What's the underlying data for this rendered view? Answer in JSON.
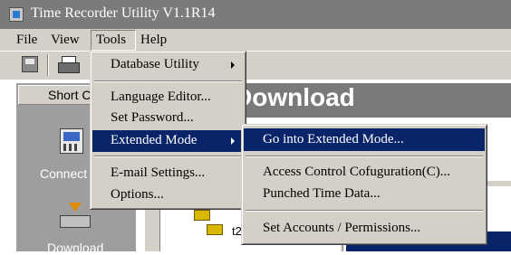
{
  "window": {
    "title": "Time Recorder Utility V1.1R14",
    "icon": "app-icon"
  },
  "menubar": {
    "file": "File",
    "view": "View",
    "tools": "Tools",
    "help": "Help"
  },
  "toolbar": {
    "save_icon": "save-icon",
    "print_icon": "printer-icon"
  },
  "shortcut_panel": {
    "header": "Short Cut",
    "connect_label": "Connect",
    "download_label": "Download"
  },
  "content": {
    "title": "Download",
    "tree_item_label": "t2"
  },
  "tools_menu": {
    "database_utility": "Database Utility",
    "language_editor": "Language Editor...",
    "set_password": "Set Password...",
    "extended_mode": "Extended Mode",
    "email_settings": "E-mail Settings...",
    "options": "Options..."
  },
  "extended_submenu": {
    "go_into": "Go into Extended Mode...",
    "access_control": "Access Control Cofuguration(C)...",
    "punched_time": "Punched Time Data...",
    "set_accounts": "Set Accounts / Permissions..."
  },
  "colors": {
    "highlight": "#0a246a",
    "menu_face": "#d4d0c8",
    "titlebar": "#7b7b7b"
  }
}
